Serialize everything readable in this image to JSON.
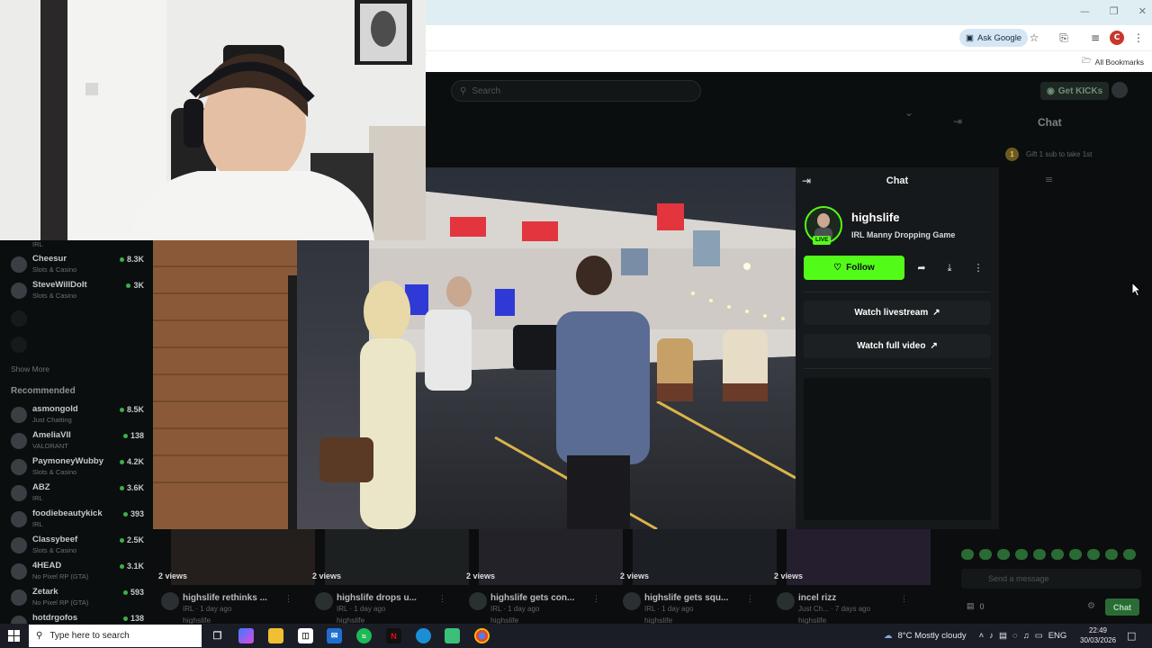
{
  "browser": {
    "ask_google": "Ask Google",
    "all_bookmarks": "All Bookmarks",
    "profile_initial": "C"
  },
  "header": {
    "search_placeholder": "Search",
    "get_kicks": "Get KICKs",
    "chat_title": "Chat"
  },
  "background_chat": {
    "gift_count": "1",
    "gift_text": "Gift 1 sub to take 1st",
    "send_placeholder": "Send a message",
    "points": "0",
    "chat_button": "Chat"
  },
  "sidebar": {
    "top_partial_category": "IRL",
    "following": [
      {
        "name": "Cheesur",
        "category": "Slots & Casino",
        "viewers": "8.3K"
      },
      {
        "name": "SteveWillDoIt",
        "category": "Slots & Casino",
        "viewers": "3K"
      }
    ],
    "show_more": "Show More",
    "recommended_title": "Recommended",
    "recommended": [
      {
        "name": "asmongold",
        "category": "Just Chatting",
        "viewers": "8.5K"
      },
      {
        "name": "AmeliaVII",
        "category": "VALORANT",
        "viewers": "138"
      },
      {
        "name": "PaymoneyWubby",
        "category": "Slots & Casino",
        "viewers": "4.2K"
      },
      {
        "name": "ABZ",
        "category": "IRL",
        "viewers": "3.6K"
      },
      {
        "name": "foodiebeautykick",
        "category": "IRL",
        "viewers": "393"
      },
      {
        "name": "Classybeef",
        "category": "Slots & Casino",
        "viewers": "2.5K"
      },
      {
        "name": "4HEAD",
        "category": "No Pixel RP (GTA)",
        "viewers": "3.1K"
      },
      {
        "name": "Zetark",
        "category": "No Pixel RP (GTA)",
        "viewers": "593"
      },
      {
        "name": "hotdrgofos",
        "category": "",
        "viewers": "138"
      }
    ]
  },
  "chat_popup": {
    "title": "Chat",
    "streamer": "highslife",
    "live_badge": "LIVE",
    "stream_title": "IRL Manny Dropping Game",
    "follow_label": "Follow",
    "watch_livestream": "Watch livestream",
    "watch_full_video": "Watch full video"
  },
  "clips": [
    {
      "views": "2 views",
      "title": "highslife rethinks ...",
      "meta": "IRL · 1 day ago",
      "channel": "highslife"
    },
    {
      "views": "2 views",
      "title": "highslife drops u...",
      "meta": "IRL · 1 day ago",
      "channel": "highslife"
    },
    {
      "views": "2 views",
      "title": "highslife gets con...",
      "meta": "IRL · 1 day ago",
      "channel": "highslife"
    },
    {
      "views": "2 views",
      "title": "highslife gets squ...",
      "meta": "IRL · 1 day ago",
      "channel": "highslife"
    },
    {
      "views": "2 views",
      "title": "incel rizz",
      "meta": "Just Ch... · 7 days ago",
      "channel": "highslife"
    }
  ],
  "taskbar": {
    "search_placeholder": "Type here to search",
    "weather": "8°C  Mostly cloudy",
    "language": "ENG",
    "time": "22:49",
    "date": "30/03/2026"
  },
  "colors": {
    "kick_green": "#53fc18",
    "background": "#0b0d0e",
    "popup_bg": "#16191b"
  }
}
